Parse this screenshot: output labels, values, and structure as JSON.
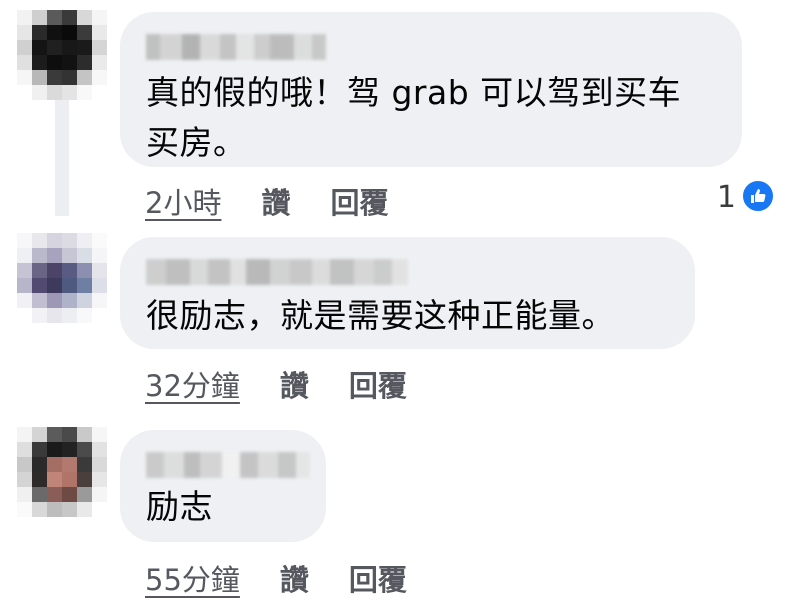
{
  "colors": {
    "bubble_bg": "#eef0f3",
    "meta_text": "#55595f",
    "like_blue": "#1877f2"
  },
  "comments": [
    {
      "text": "真的假的哦！驾 grab 可以驾到买车\n买房。",
      "time": "2小時",
      "like_label": "讚",
      "reply_label": "回覆",
      "reaction_count": "1",
      "reaction_icon": "thumbs-up-icon"
    },
    {
      "text": "很励志，就是需要这种正能量。",
      "time": "32分鐘",
      "like_label": "讚",
      "reply_label": "回覆"
    },
    {
      "text": "励志",
      "time": "55分鐘",
      "like_label": "讚",
      "reply_label": "回覆"
    }
  ]
}
